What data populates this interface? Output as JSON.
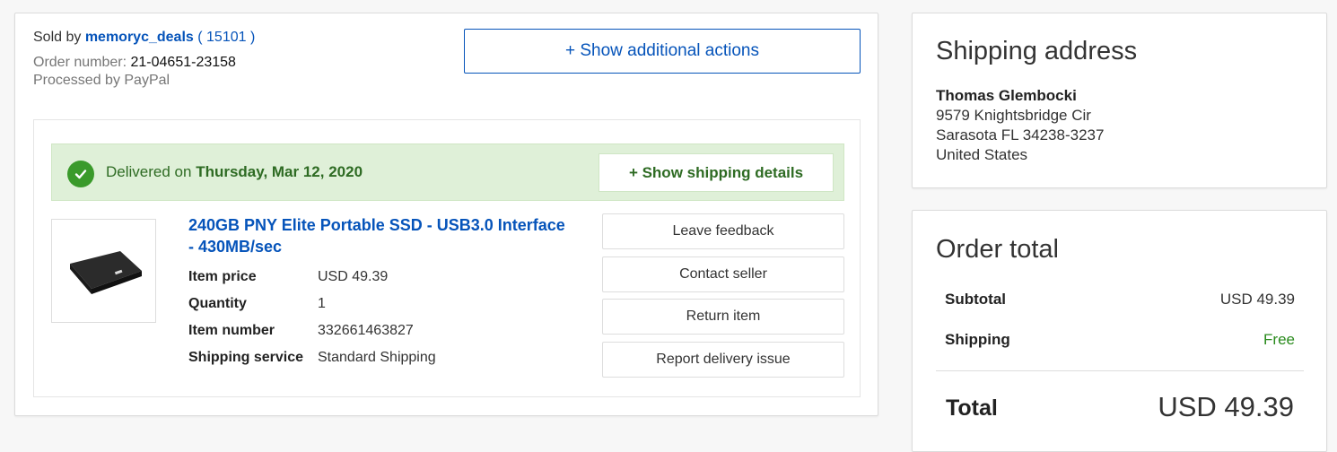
{
  "order": {
    "sold_by_label": "Sold by",
    "seller": "memoryc_deals",
    "feedback_open": "(",
    "feedback_score": "15101",
    "feedback_close": ")",
    "order_number_label": "Order number:",
    "order_number": "21-04651-23158",
    "processed_by": "Processed by PayPal",
    "show_actions_label": "+ Show additional actions"
  },
  "delivery": {
    "prefix": "Delivered on",
    "date": "Thursday, Mar 12, 2020",
    "show_shipping_label": "+ Show shipping details"
  },
  "item": {
    "title": "240GB PNY Elite Portable SSD - USB3.0 Interface - 430MB/sec",
    "specs": [
      {
        "label": "Item price",
        "value": "USD 49.39"
      },
      {
        "label": "Quantity",
        "value": "1"
      },
      {
        "label": "Item number",
        "value": "332661463827"
      },
      {
        "label": "Shipping service",
        "value": "Standard Shipping"
      }
    ]
  },
  "actions": [
    "Leave feedback",
    "Contact seller",
    "Return item",
    "Report delivery issue"
  ],
  "shipping_address": {
    "title": "Shipping address",
    "name": "Thomas Glembocki",
    "line1": "9579 Knightsbridge Cir",
    "line2": "Sarasota FL 34238-3237",
    "line3": "United States"
  },
  "order_total": {
    "title": "Order total",
    "subtotal_label": "Subtotal",
    "subtotal": "USD 49.39",
    "shipping_label": "Shipping",
    "shipping": "Free",
    "total_label": "Total",
    "total": "USD 49.39"
  },
  "colors": {
    "link": "#0654ba",
    "success": "#3a9a2b",
    "success_bg": "#dff0d8"
  },
  "icons": [
    "check-circle-icon",
    "ssd-product-image"
  ]
}
